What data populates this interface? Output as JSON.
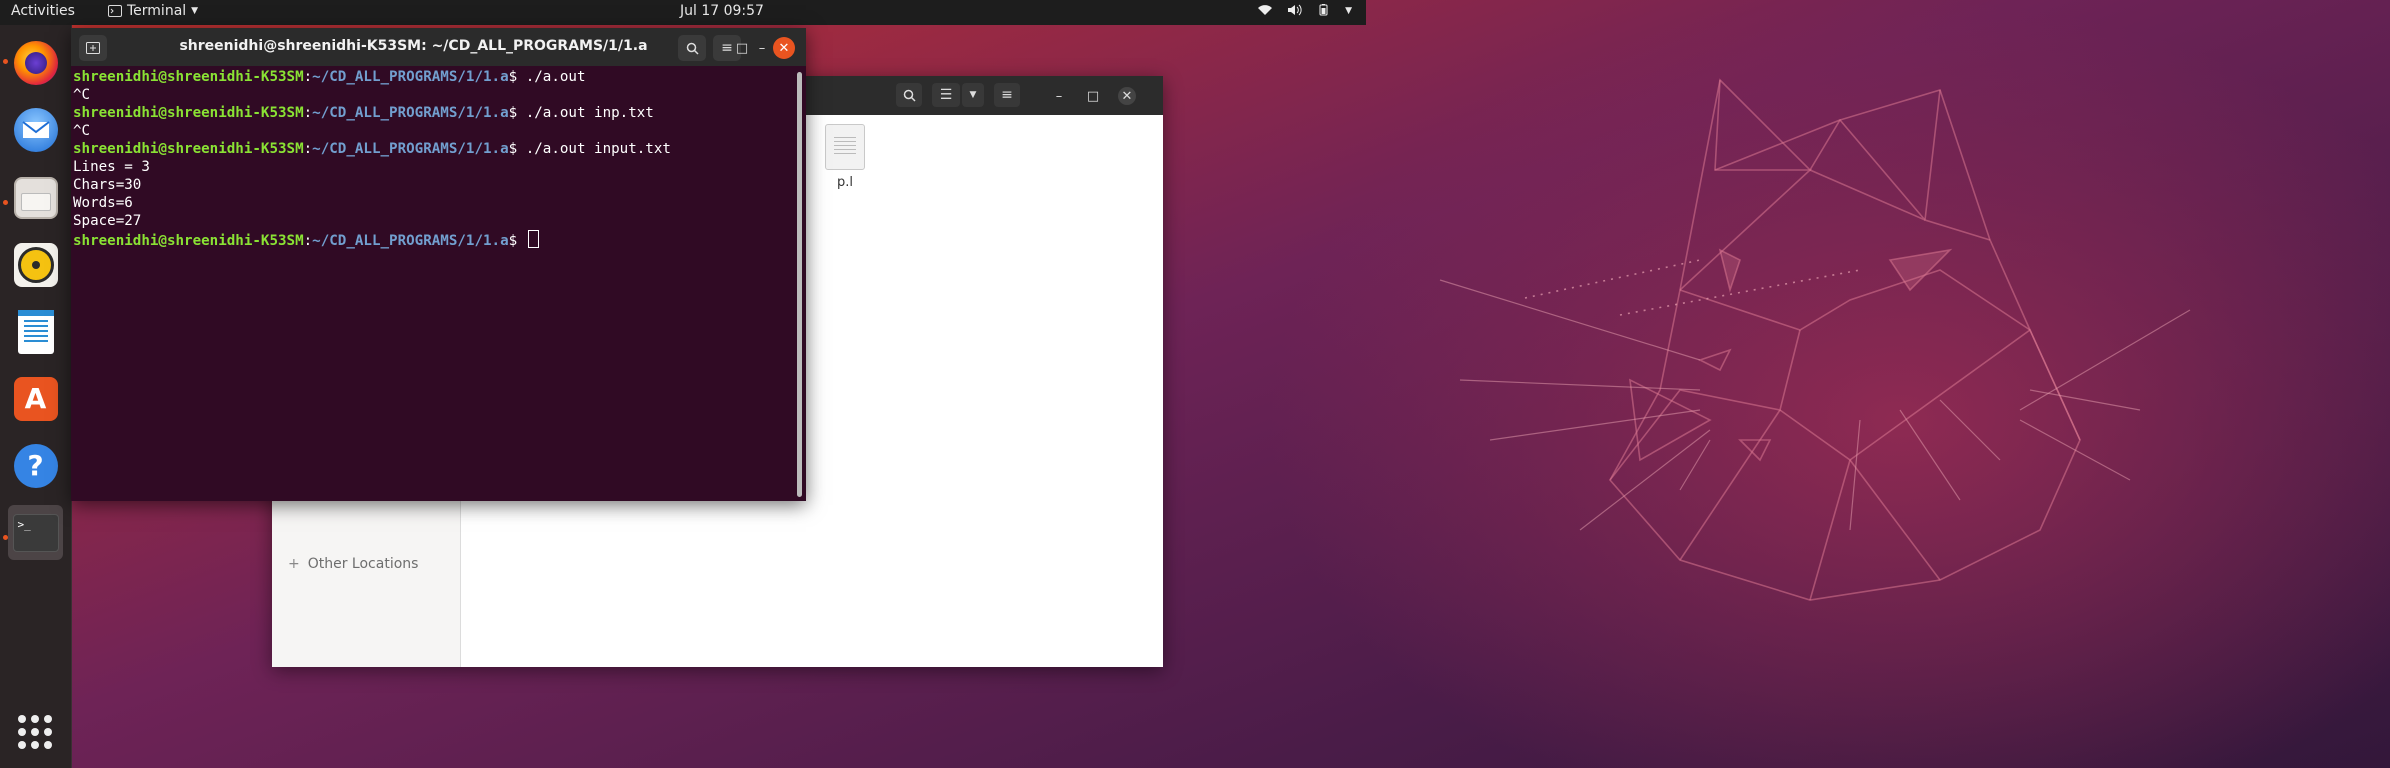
{
  "topbar": {
    "activities": "Activities",
    "app_name": "Terminal",
    "app_dropdown_icon": "caret-down-icon",
    "clock": "Jul 17  09:57",
    "status_icons": [
      "network-icon",
      "volume-icon",
      "battery-icon",
      "caret-down-icon"
    ]
  },
  "dock": {
    "items": [
      {
        "name": "firefox",
        "icon": "firefox-icon",
        "running": true
      },
      {
        "name": "thunderbird",
        "icon": "thunderbird-icon",
        "running": false
      },
      {
        "name": "files",
        "icon": "files-icon",
        "running": true
      },
      {
        "name": "rhythmbox",
        "icon": "rhythmbox-icon",
        "running": false
      },
      {
        "name": "libreoffice-writer",
        "icon": "writer-icon",
        "running": false
      },
      {
        "name": "software",
        "icon": "software-icon",
        "running": false
      },
      {
        "name": "help",
        "icon": "help-icon",
        "running": false
      },
      {
        "name": "terminal",
        "icon": "terminal-icon",
        "running": true,
        "active": true
      }
    ],
    "apps_grid_icon": "show-applications-icon"
  },
  "files_window": {
    "sidebar_other_locations": "Other Locations",
    "file_name": "p.l"
  },
  "terminal": {
    "title": "shreenidhi@shreenidhi-K53SM: ~/CD_ALL_PROGRAMS/1/1.a",
    "user_host": "shreenidhi@shreenidhi-K53SM",
    "path": "~/CD_ALL_PROGRAMS/1/1.a",
    "lines": [
      {
        "type": "prompt",
        "cmd": " ./a.out"
      },
      {
        "type": "out",
        "text": "^C"
      },
      {
        "type": "prompt",
        "cmd": " ./a.out inp.txt"
      },
      {
        "type": "out",
        "text": "^C"
      },
      {
        "type": "prompt",
        "cmd": " ./a.out input.txt"
      },
      {
        "type": "out",
        "text": "Lines = 3"
      },
      {
        "type": "out",
        "text": "Chars=30"
      },
      {
        "type": "out",
        "text": "Words=6"
      },
      {
        "type": "out",
        "text": "Space=27"
      },
      {
        "type": "prompt",
        "cmd": " ",
        "cursor": true
      }
    ]
  },
  "colors": {
    "terminal_bg": "#300a24",
    "prompt_user": "#8ae234",
    "prompt_path": "#729fcf",
    "close_button": "#e95420"
  }
}
